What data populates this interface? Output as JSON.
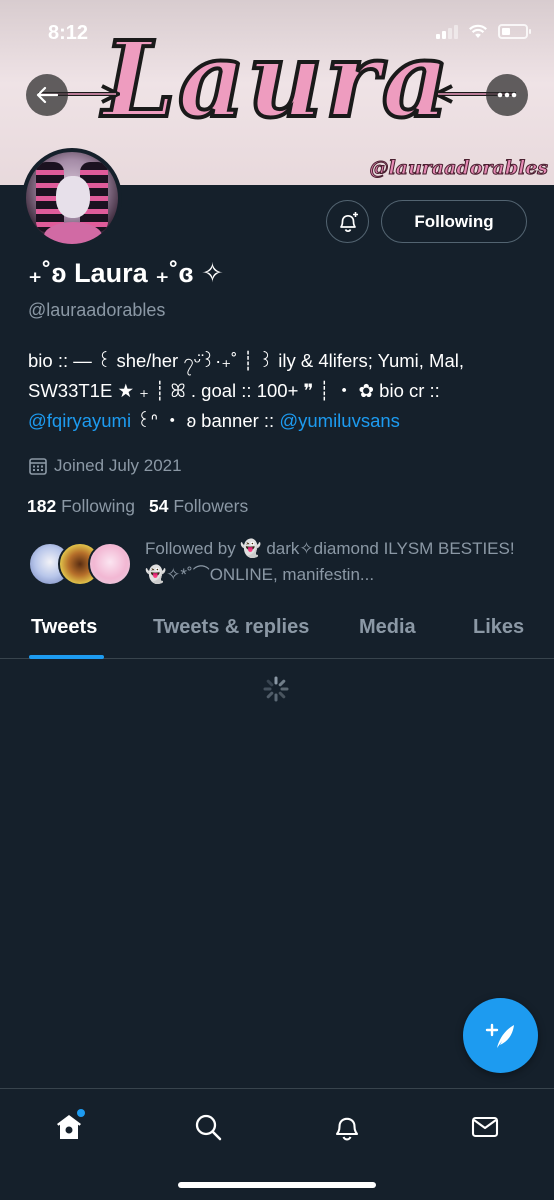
{
  "status_bar": {
    "time": "8:12"
  },
  "banner": {
    "title": "Laura",
    "watermark": "@lauraadorables"
  },
  "profile": {
    "display_name": "₊˚ʚ Laura ₊˚ɞ ✧",
    "handle": "@lauraadorables",
    "bio_line1": "bio :: ― ꒰ she/her ၇ᵕ̈꒱·₊˚ ┊ ꒱ ily & 4lifers; Yumi, Mal,",
    "bio_line2": "SW33T1E ★ ₊ ┊ ꕤ . goal :: 100+ ❞ ┊ ・ ✿ bio cr ::",
    "bio_link1": "@fqiryayumi",
    "bio_mid": " ꒰ᐢ ・ ʚ banner :: ",
    "bio_link2": "@yumiluvsans",
    "joined": "Joined July 2021",
    "following_count": "182",
    "following_label": "Following",
    "followers_count": "54",
    "followers_label": "Followers",
    "followed_by": "Followed by 👻 dark✧diamond ILYSM BESTIES!👻✧*˚⌒ONLINE, manifestin..."
  },
  "buttons": {
    "following": "Following"
  },
  "tabs": [
    {
      "label": "Tweets",
      "active": true
    },
    {
      "label": "Tweets & replies",
      "active": false
    },
    {
      "label": "Media",
      "active": false
    },
    {
      "label": "Likes",
      "active": false
    }
  ],
  "bottom_nav": {
    "items": [
      {
        "icon": "home-icon",
        "has_notification_dot": true
      },
      {
        "icon": "search-icon"
      },
      {
        "icon": "bell-icon"
      },
      {
        "icon": "mail-icon"
      }
    ]
  },
  "colors": {
    "background": "#15202b",
    "accent": "#1d9bf0",
    "secondary_text": "#8b98a5",
    "border": "#38444d",
    "banner_pink": "#ee9cbf"
  }
}
